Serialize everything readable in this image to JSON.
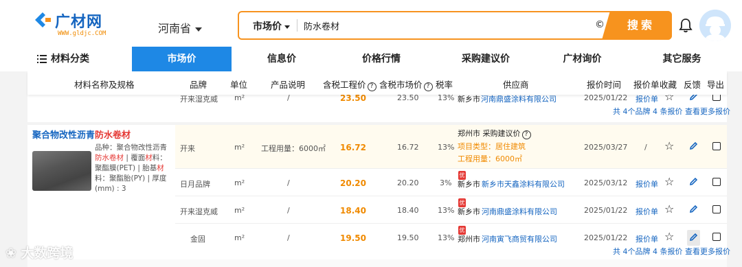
{
  "header": {
    "logo_text": "广材网",
    "logo_url": "WWW.gldjc.COM",
    "province": "河南省",
    "search": {
      "scope": "市场价",
      "value": "防水卷材",
      "clear_symbol": "©",
      "button_label": "搜索"
    },
    "accent_color": "#f7931e",
    "brand_color": "#1565c0"
  },
  "nav": {
    "categories_label": "材料分类",
    "items": [
      {
        "label": "市场价",
        "active": true
      },
      {
        "label": "信息价"
      },
      {
        "label": "价格行情"
      },
      {
        "label": "采购建议价"
      },
      {
        "label": "广材询价"
      },
      {
        "label": "其它服务"
      }
    ]
  },
  "table": {
    "headers": {
      "name": "材料名称及规格",
      "brand": "品牌",
      "unit": "单位",
      "desc": "产品说明",
      "eng_price": "含税工程价",
      "market_price": "含税市场价",
      "tax": "税率",
      "supplier": "供应商",
      "time": "报价时间",
      "quote": "报价单",
      "fav": "收藏",
      "feedback": "反馈",
      "export": "导出"
    },
    "group1_partial_row": {
      "brand": "开来湿克威",
      "unit": "m²",
      "desc": "/",
      "eng_price": "23.50",
      "market_price": "23.50",
      "tax": "13%",
      "city": "新乡市",
      "supplier": "河南鼎盛涂料有限公司",
      "time": "2025/01/22",
      "quote": "报价单"
    },
    "group1_more": "共 4个品牌 4 条报价 查看更多报价",
    "group2": {
      "title_prefix": "聚合物改性沥青",
      "title_highlight": "防水卷材",
      "desc_lines": {
        "l1": "品种：聚合物改性沥青",
        "l2a": "防水卷材",
        "l2b": " | 覆面",
        "l2c": "材",
        "l2d": "料：",
        "l3a": "聚酯膜(PET) | 胎基",
        "l3b": "材",
        "l4": "料：聚酯胎(PY) | 厚度",
        "l5": "(mm) : 3"
      },
      "rows": [
        {
          "brand": "开来",
          "unit": "m²",
          "desc": "工程用量：6000㎡",
          "eng_price": "16.72",
          "market_price": "16.72",
          "tax": "13%",
          "supplier_line1": "郑州市 采购建议价",
          "supplier_line2": "项目类型：居住建筑",
          "supplier_line3": "工程用量：6000㎡",
          "time": "2025/03/27",
          "quote": "/"
        },
        {
          "brand": "日月品牌",
          "unit": "m²",
          "desc": "/",
          "eng_price": "20.20",
          "market_price": "20.20",
          "tax": "3%",
          "badge": "优",
          "city": "新乡市",
          "supplier": "新乡市天鑫涂料有限公司",
          "time": "2025/03/12",
          "quote": "报价单"
        },
        {
          "brand": "开来湿克威",
          "unit": "m²",
          "desc": "/",
          "eng_price": "18.40",
          "market_price": "18.40",
          "tax": "13%",
          "badge": "优",
          "city": "新乡市",
          "supplier": "河南鼎盛涂料有限公司",
          "time": "2025/01/22",
          "quote": "报价单"
        },
        {
          "brand": "金固",
          "unit": "m²",
          "desc": "/",
          "eng_price": "19.50",
          "market_price": "19.50",
          "tax": "13%",
          "badge": "优",
          "city": "郑州市",
          "supplier": "河南寅飞商贸有限公司",
          "time": "2025/01/22",
          "quote": "报价单"
        }
      ],
      "more": "共 4个品牌 4 条报价 查看更多报价"
    }
  },
  "watermark": "大数跨境"
}
